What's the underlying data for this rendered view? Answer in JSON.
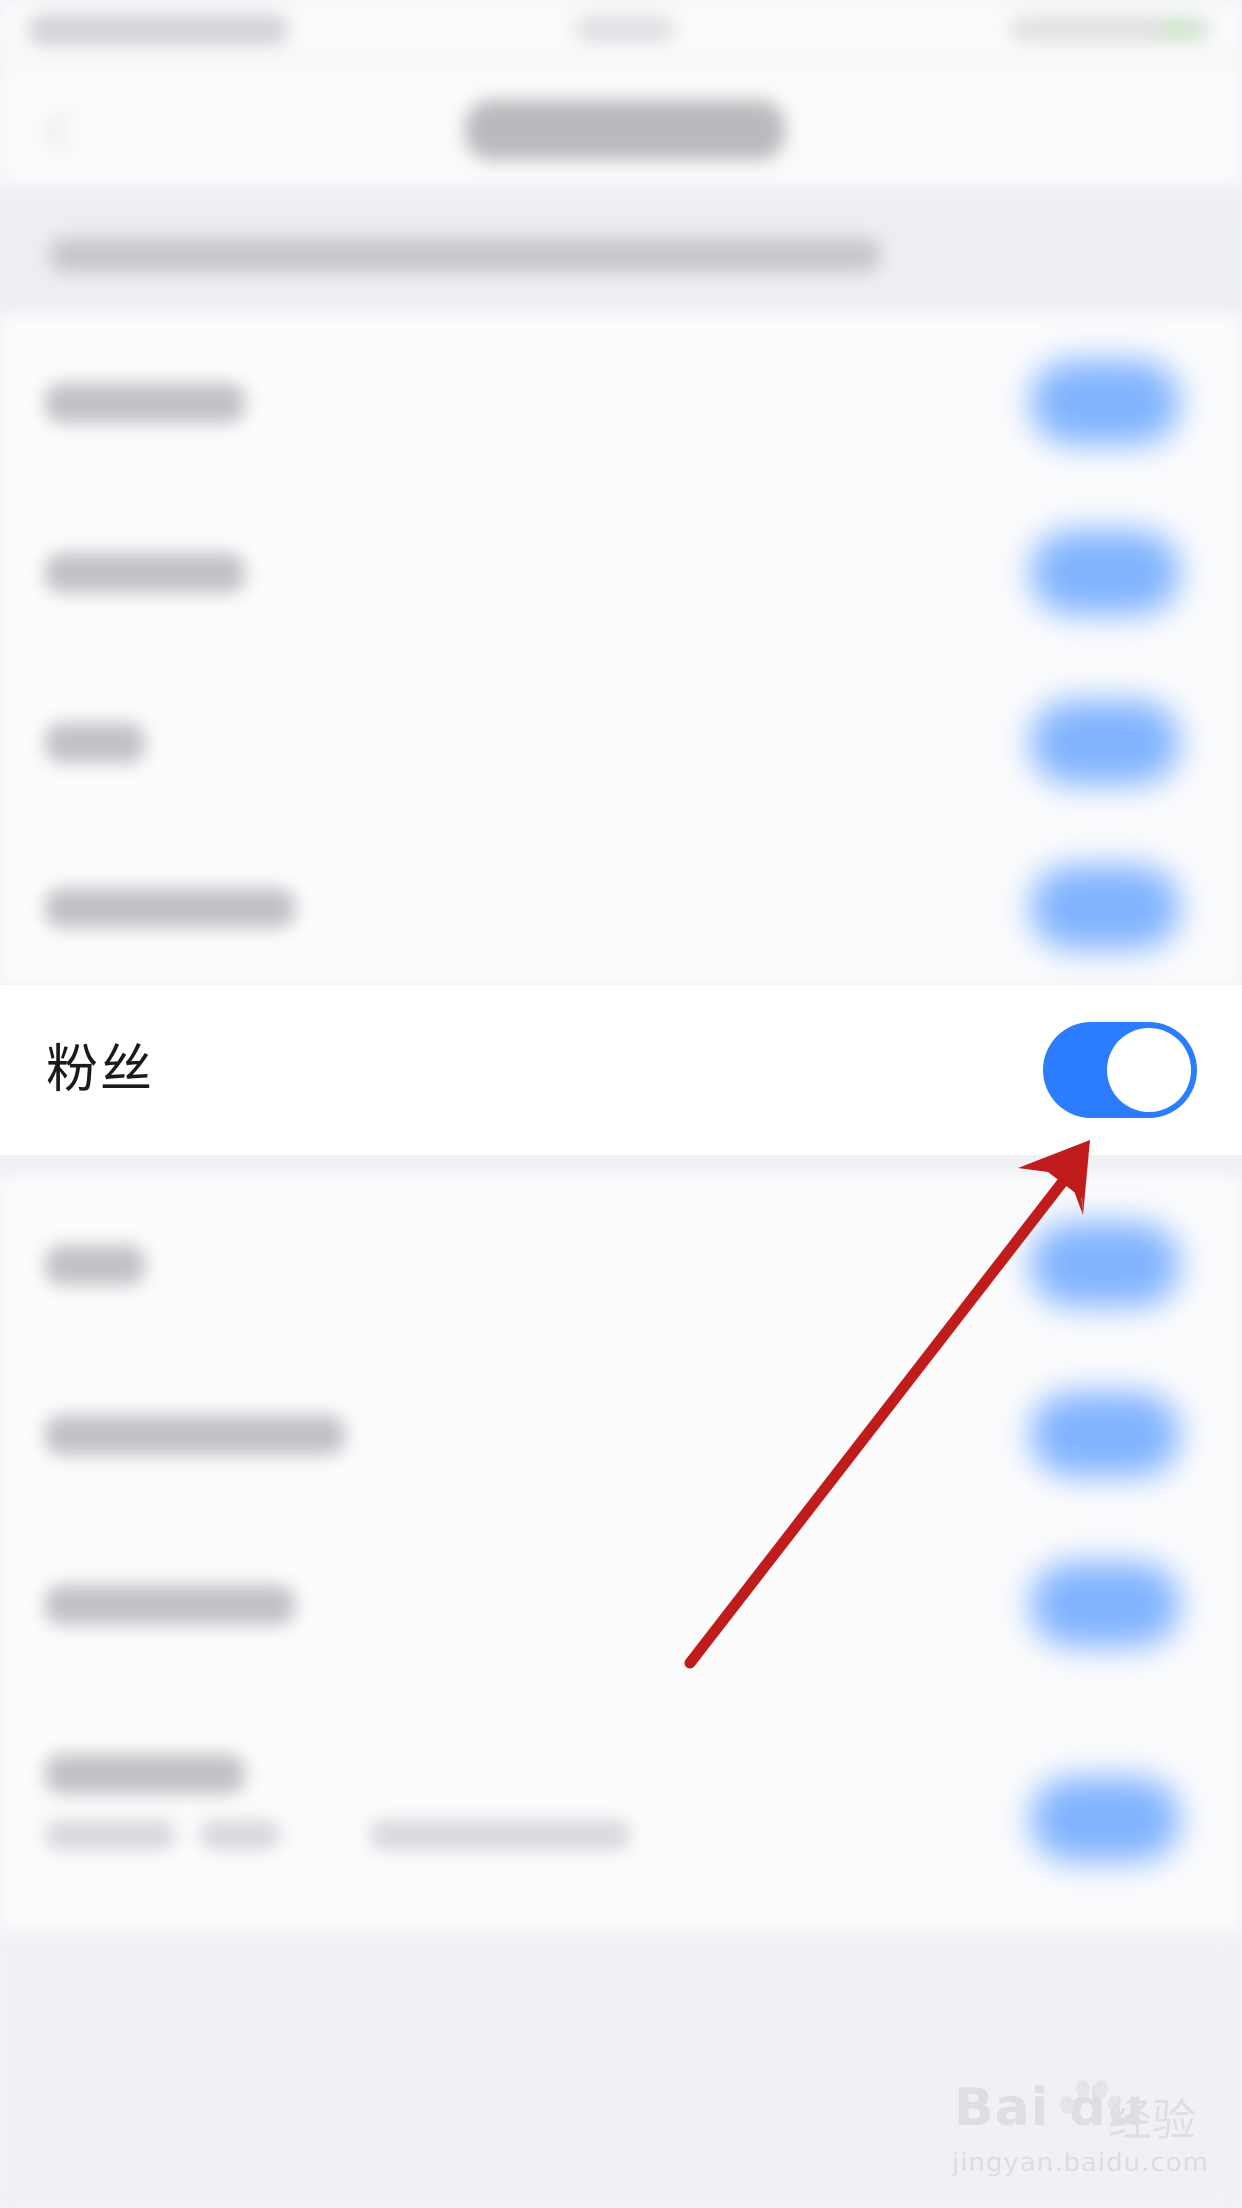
{
  "focused_setting": {
    "label": "粉丝",
    "toggle_state": "on"
  },
  "colors": {
    "toggle_on": "#2b7dfe",
    "arrow": "#c01c1c",
    "background": "#f1f2f6"
  },
  "watermark": {
    "logo": "Bai du",
    "brand_cn": "经验",
    "url": "jingyan.baidu.com"
  }
}
